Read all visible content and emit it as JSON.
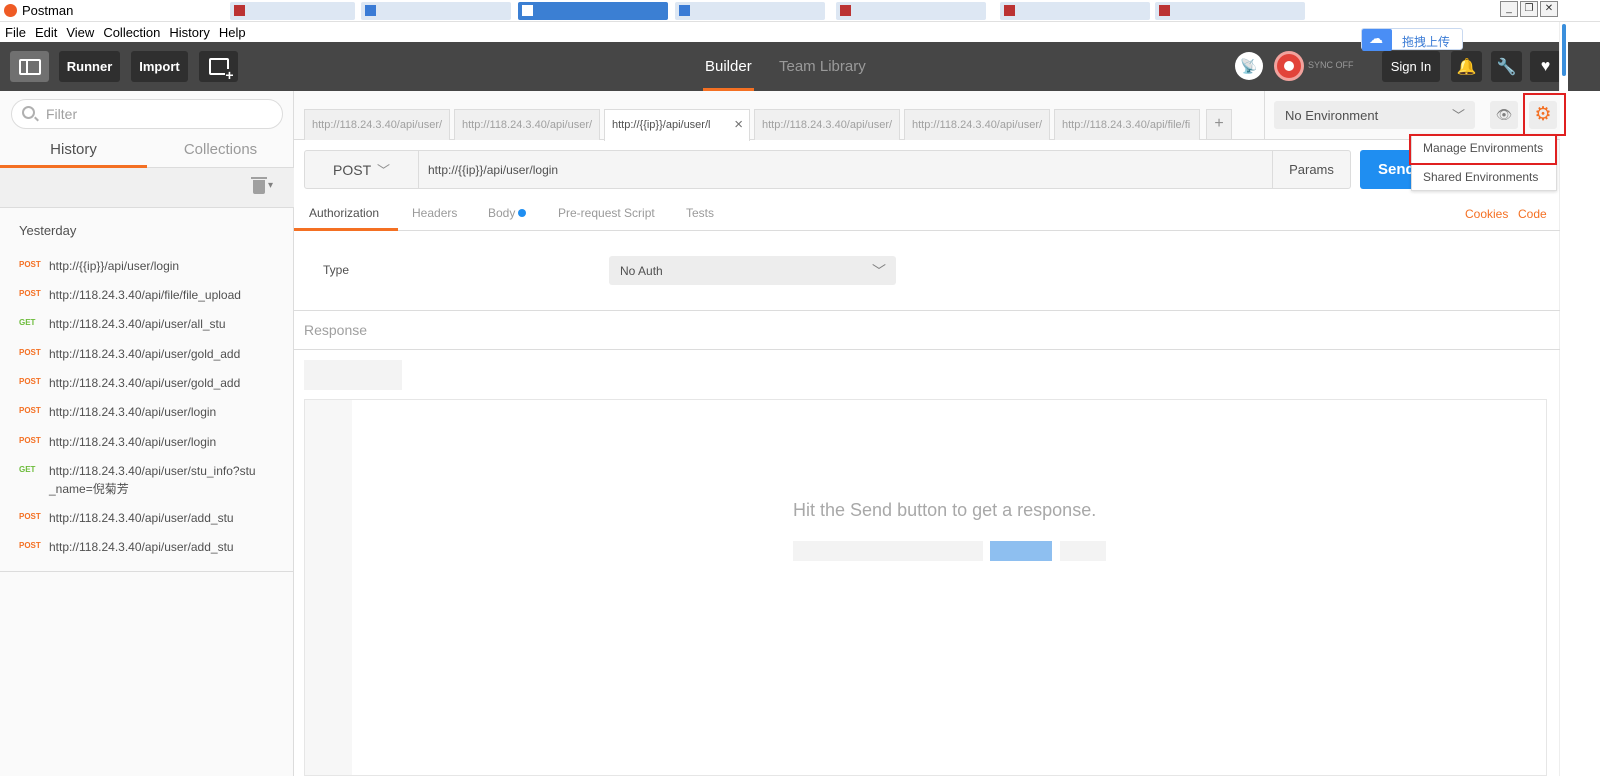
{
  "window": {
    "title": "Postman"
  },
  "menu": [
    "File",
    "Edit",
    "View",
    "Collection",
    "History",
    "Help"
  ],
  "toolbar": {
    "runner": "Runner",
    "import": "Import",
    "builder": "Builder",
    "team_library": "Team Library",
    "sync_status": "SYNC OFF",
    "sign_in": "Sign In"
  },
  "overlay_widget": {
    "label": "拖拽上传"
  },
  "sidebar": {
    "filter_placeholder": "Filter",
    "tabs": {
      "history": "History",
      "collections": "Collections"
    },
    "group_label": "Yesterday",
    "items": [
      {
        "method": "POST",
        "url": "http://{{ip}}/api/user/login"
      },
      {
        "method": "POST",
        "url": "http://118.24.3.40/api/file/file_upload"
      },
      {
        "method": "GET",
        "url": "http://118.24.3.40/api/user/all_stu"
      },
      {
        "method": "POST",
        "url": "http://118.24.3.40/api/user/gold_add"
      },
      {
        "method": "POST",
        "url": "http://118.24.3.40/api/user/gold_add"
      },
      {
        "method": "POST",
        "url": "http://118.24.3.40/api/user/login"
      },
      {
        "method": "POST",
        "url": "http://118.24.3.40/api/user/login"
      },
      {
        "method": "GET",
        "url": "http://118.24.3.40/api/user/stu_info?stu_name=倪菊芳"
      },
      {
        "method": "POST",
        "url": "http://118.24.3.40/api/user/add_stu"
      },
      {
        "method": "POST",
        "url": "http://118.24.3.40/api/user/add_stu"
      }
    ]
  },
  "request_tabs": [
    {
      "label": "http://118.24.3.40/api/user/",
      "active": false
    },
    {
      "label": "http://118.24.3.40/api/user/",
      "active": false
    },
    {
      "label": "http://{{ip}}/api/user/l",
      "active": true
    },
    {
      "label": "http://118.24.3.40/api/user/",
      "active": false
    },
    {
      "label": "http://118.24.3.40/api/user/",
      "active": false
    },
    {
      "label": "http://118.24.3.40/api/file/fi",
      "active": false
    }
  ],
  "new_tab_label": "+",
  "environment": {
    "selected": "No Environment",
    "menu": [
      "Manage Environments",
      "Shared Environments"
    ]
  },
  "request": {
    "method": "POST",
    "url": "http://{{ip}}/api/user/login",
    "params_label": "Params",
    "send_label": "Send"
  },
  "request_subtabs": [
    "Authorization",
    "Headers",
    "Body",
    "Pre-request Script",
    "Tests"
  ],
  "links": {
    "cookies": "Cookies",
    "code": "Code"
  },
  "auth": {
    "type_label": "Type",
    "type_value": "No Auth"
  },
  "response": {
    "label": "Response",
    "empty_message": "Hit the Send button to get a response."
  },
  "colors": {
    "accent": "#f47023",
    "send_blue": "#1f8ef1",
    "get_green": "#6cbb3a",
    "highlight_red": "#e02020"
  }
}
